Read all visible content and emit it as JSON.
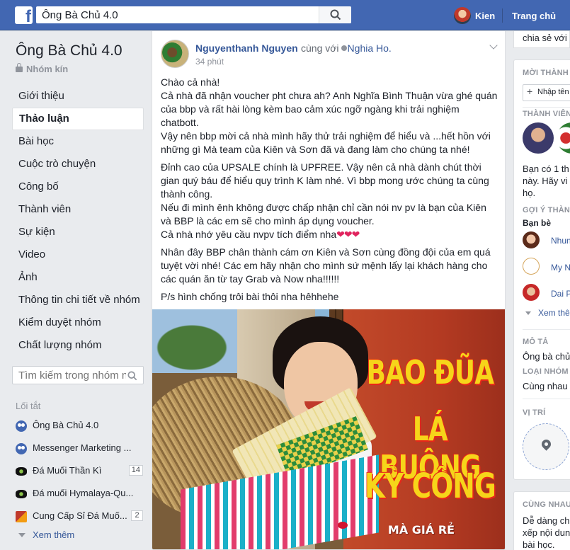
{
  "topbar": {
    "search_value": "Ông Bà Chủ 4.0",
    "user_name": "Kien",
    "home_label": "Trang chủ"
  },
  "group": {
    "title": "Ông Bà Chủ 4.0",
    "privacy": "Nhóm kín"
  },
  "nav": {
    "items": [
      {
        "label": "Giới thiệu"
      },
      {
        "label": "Thảo luận",
        "active": true
      },
      {
        "label": "Bài học"
      },
      {
        "label": "Cuộc trò chuyện"
      },
      {
        "label": "Công bố"
      },
      {
        "label": "Thành viên"
      },
      {
        "label": "Sự kiện"
      },
      {
        "label": "Video"
      },
      {
        "label": "Ảnh"
      },
      {
        "label": "Thông tin chi tiết về nhóm"
      },
      {
        "label": "Kiểm duyệt nhóm"
      },
      {
        "label": "Chất lượng nhóm"
      }
    ]
  },
  "group_search": {
    "placeholder": "Tìm kiếm trong nhóm này"
  },
  "shortcuts": {
    "title": "Lối tắt",
    "items": [
      {
        "label": "Ông Bà Chủ 4.0",
        "icon": "group-icon",
        "count": ""
      },
      {
        "label": "Messenger Marketing ...",
        "icon": "group-icon",
        "count": ""
      },
      {
        "label": "Đá Muối Thần Kì",
        "icon": "stone-page-icon",
        "count": "14"
      },
      {
        "label": "Đá muối Hymalaya-Qu...",
        "icon": "stone-page-icon",
        "count": ""
      },
      {
        "label": "Cung Cấp Sỉ Đá Muố...",
        "icon": "page-flag-icon",
        "count": "2"
      }
    ],
    "see_more": "Xem thêm"
  },
  "post": {
    "author": "Nguyenthanh Nguyen",
    "with_text": "cùng với",
    "with_name": "Nghia Ho.",
    "time": "34 phút",
    "paragraphs": [
      [
        "Chào cả nhà!",
        "Cả nhà đã nhận voucher pht chưa ah? Anh Nghĩa Bình Thuận vừa ghé quán của bbp và rất hài lòng kèm bao cảm xúc ngỡ ngàng khi trải nghiệm chatbott.",
        "Vậy nên bbp mời cả nhà mình hãy thử trải nghiệm để hiểu và ...hết hồn với những gì Mà team của Kiên và Sơn đã và đang làm cho chúng ta nhé!"
      ],
      [
        "Đỉnh cao của UPSALE chính là UPFREE. Vậy nên cả nhà dành chút thời gian quý báu để hiểu quy trình K làm nhé. Vì bbp mong ước chúng ta cùng thành công.",
        "Nếu đi mình ênh không được chấp nhận chỉ cần nói nv pv là bạn của Kiên và BBP là các em sẽ cho mình áp dụng voucher.",
        "Cả nhà nhớ yêu cầu nvpv tích điểm nha"
      ],
      [
        "Nhân đây BBP chân thành cám ơn Kiên và Sơn cùng đồng đội của em quá tuyệt vời nhé! Các em hãy nhận cho mình sứ mệnh lấy lại khách hàng cho các quán ăn từ tay Grab và Now nha!!!!!!"
      ],
      [
        "P/s hình chống trôi bài thôi nha hêhhehe"
      ]
    ],
    "hearts": "❤❤❤",
    "image_text": {
      "line1": "BAO ĐŨA",
      "line2": "LÁ BUÔNG",
      "line3": "KỲ CÔNG",
      "small": "MÀ GIÁ RẺ"
    }
  },
  "right": {
    "top_text": "chia sẻ với",
    "members_label": "MỜI THÀNH VIÊN",
    "invite_placeholder": "Nhập tên",
    "member_section": "THÀNH VIÊN",
    "member_text_1": "Bạn có 1 th",
    "member_text_2": "này. Hãy vi",
    "member_text_3": "họ.",
    "suggest_label": "GỢI Ý THÀNH",
    "friends_label": "Bạn bè",
    "suggestions": [
      "Nhung",
      "My N",
      "Dai P"
    ],
    "see_more": "Xem thê",
    "desc_label": "MÔ TẢ",
    "desc_text": "Ông bà chủ",
    "type_label": "LOẠI NHÓM",
    "type_text": "Cùng nhau",
    "location_label": "VỊ TRÍ",
    "card2_label": "CÙNG NHAU",
    "card2_text_1": "Dễ dàng chi",
    "card2_text_2": "xếp nội dung",
    "card2_text_3": "bài học."
  }
}
